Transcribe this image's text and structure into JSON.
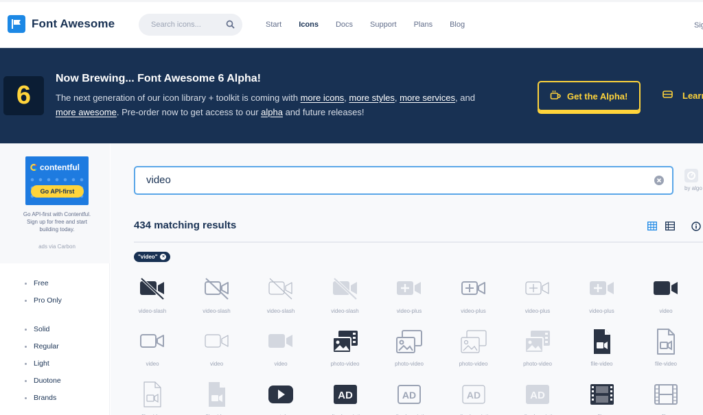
{
  "nav": {
    "brand": "Font Awesome",
    "search_placeholder": "Search icons...",
    "links": [
      "Start",
      "Icons",
      "Docs",
      "Support",
      "Plans",
      "Blog"
    ],
    "active_link": "Icons",
    "signin_partial": "Sig"
  },
  "banner": {
    "badge": "6",
    "title": "Now Brewing... Font Awesome 6 Alpha!",
    "text_1": "The next generation of our icon library + toolkit is coming with ",
    "link_more_icons": "more icons",
    "sep_1": ", ",
    "link_more_styles": "more styles",
    "sep_2": ", ",
    "link_more_services": "more services",
    "text_2": ", and",
    "link_more_awesome": "more awesome",
    "text_3": ". Pre-order now to get access to our ",
    "link_alpha": "alpha",
    "text_4": " and future releases!",
    "cta": "Get the Alpha!",
    "learn_partial": "Learn",
    "colors": {
      "background": "#183153",
      "accent": "#ffd43b"
    }
  },
  "ad": {
    "logo": "contentful",
    "pill": "Go API-first",
    "text": "Go API-first with Contentful. Sign up for free and start building today.",
    "via": "ads via Carbon"
  },
  "filters": {
    "group_1": [
      "Free",
      "Pro Only"
    ],
    "group_2": [
      "Solid",
      "Regular",
      "Light",
      "Duotone",
      "Brands"
    ]
  },
  "search": {
    "value": "video",
    "powered_by_partial": "by algo"
  },
  "results": {
    "count_label": "434 matching results",
    "chip": "\"video\""
  },
  "icons": [
    {
      "label": "video-slash",
      "icon": "video-slash-icon",
      "style": "solid"
    },
    {
      "label": "video-slash",
      "icon": "video-slash-icon",
      "style": "regular"
    },
    {
      "label": "video-slash",
      "icon": "video-slash-icon",
      "style": "light"
    },
    {
      "label": "video-slash",
      "icon": "video-slash-icon",
      "style": "duotone"
    },
    {
      "label": "video-plus",
      "icon": "video-plus-icon",
      "style": "solid-light"
    },
    {
      "label": "video-plus",
      "icon": "video-plus-icon",
      "style": "regular"
    },
    {
      "label": "video-plus",
      "icon": "video-plus-icon",
      "style": "light"
    },
    {
      "label": "video-plus",
      "icon": "video-plus-icon",
      "style": "duotone"
    },
    {
      "label": "video",
      "icon": "video-icon",
      "style": "solid"
    },
    {
      "label": "video",
      "icon": "video-icon",
      "style": "regular"
    },
    {
      "label": "video",
      "icon": "video-icon",
      "style": "light"
    },
    {
      "label": "video",
      "icon": "video-icon",
      "style": "duotone"
    },
    {
      "label": "photo-video",
      "icon": "photo-video-icon",
      "style": "solid"
    },
    {
      "label": "photo-video",
      "icon": "photo-video-icon",
      "style": "regular"
    },
    {
      "label": "photo-video",
      "icon": "photo-video-icon",
      "style": "light"
    },
    {
      "label": "photo-video",
      "icon": "photo-video-icon",
      "style": "duotone"
    },
    {
      "label": "file-video",
      "icon": "file-video-icon",
      "style": "solid"
    },
    {
      "label": "file-video",
      "icon": "file-video-icon",
      "style": "regular"
    },
    {
      "label": "file-video",
      "icon": "file-video-icon",
      "style": "light"
    },
    {
      "label": "file-video",
      "icon": "file-video-icon",
      "style": "duotone"
    },
    {
      "label": "youtube",
      "icon": "youtube-icon",
      "style": "brand"
    },
    {
      "label": "audio-description",
      "icon": "audio-description-icon",
      "style": "solid"
    },
    {
      "label": "audio-description",
      "icon": "audio-description-icon",
      "style": "regular"
    },
    {
      "label": "audio-description",
      "icon": "audio-description-icon",
      "style": "light"
    },
    {
      "label": "audio-description",
      "icon": "audio-description-icon",
      "style": "duotone"
    },
    {
      "label": "film",
      "icon": "film-icon",
      "style": "solid"
    },
    {
      "label": "film",
      "icon": "film-icon",
      "style": "regular"
    }
  ]
}
